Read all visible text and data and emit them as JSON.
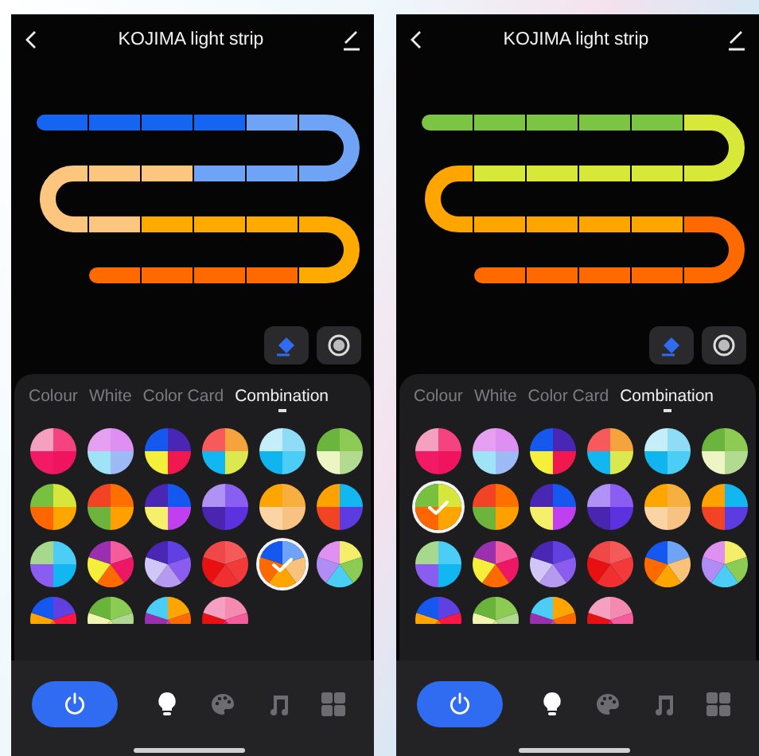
{
  "screens": [
    {
      "title": "KOJIMA light strip",
      "strip": [
        {
          "color": "#1565f0"
        },
        {
          "color": "#1565f0"
        },
        {
          "color": "#1565f0"
        },
        {
          "color": "#1565f0"
        },
        {
          "color": "#6fa3f5"
        },
        {
          "color": "#6fa3f5"
        },
        {
          "color": "#6fa3f5"
        },
        {
          "color": "#6fa3f5"
        },
        {
          "color": "#fcc67e"
        },
        {
          "color": "#fcc67e"
        },
        {
          "color": "#fcc67e"
        },
        {
          "color": "#fcc67e"
        },
        {
          "color": "#ffaa00"
        },
        {
          "color": "#ffaa00"
        },
        {
          "color": "#ffaa00"
        },
        {
          "color": "#ffaa00"
        },
        {
          "color": "#ff6a00"
        },
        {
          "color": "#ff6a00"
        },
        {
          "color": "#ff6a00"
        },
        {
          "color": "#ff6a00"
        }
      ],
      "tabs": [
        {
          "label": "Colour",
          "selected": false
        },
        {
          "label": "White",
          "selected": false
        },
        {
          "label": "Color Card",
          "selected": false
        },
        {
          "label": "Combination",
          "selected": true
        }
      ],
      "swatches": [
        {
          "slices": [
            {
              "color": "#f5437f"
            },
            {
              "color": "#f0145e"
            },
            {
              "color": "#f21a64"
            },
            {
              "color": "#f4a0be"
            }
          ],
          "selected": false
        },
        {
          "slices": [
            {
              "color": "#de90f2"
            },
            {
              "color": "#9dbaf7"
            },
            {
              "color": "#9fe3f7"
            },
            {
              "color": "#e6a0f2"
            }
          ],
          "selected": false
        },
        {
          "slices": [
            {
              "color": "#4a26b4"
            },
            {
              "color": "#f0184e"
            },
            {
              "color": "#f5ee3a"
            },
            {
              "color": "#1458f0"
            }
          ],
          "selected": false
        },
        {
          "slices": [
            {
              "color": "#f5a33c"
            },
            {
              "color": "#dbe94e"
            },
            {
              "color": "#12b6f0"
            },
            {
              "color": "#f65a5a"
            }
          ],
          "selected": false
        },
        {
          "slices": [
            {
              "color": "#8fdcf7"
            },
            {
              "color": "#4ccdf5"
            },
            {
              "color": "#10b5ef"
            },
            {
              "color": "#c5edfa"
            }
          ],
          "selected": false
        },
        {
          "slices": [
            {
              "color": "#8ecb55"
            },
            {
              "color": "#b2da90"
            },
            {
              "color": "#eef5c5"
            },
            {
              "color": "#6bb43e"
            }
          ],
          "selected": false
        },
        {
          "slices": [
            {
              "color": "#d6e63a"
            },
            {
              "color": "#ffa500"
            },
            {
              "color": "#ff6600"
            },
            {
              "color": "#78c040"
            }
          ],
          "selected": false
        },
        {
          "slices": [
            {
              "color": "#ff7000"
            },
            {
              "color": "#ffa000"
            },
            {
              "color": "#6cb43c"
            },
            {
              "color": "#f24424"
            }
          ],
          "selected": false
        },
        {
          "slices": [
            {
              "color": "#1458f0"
            },
            {
              "color": "#c040f0"
            },
            {
              "color": "#f5ef6a"
            },
            {
              "color": "#4a26b4"
            }
          ],
          "selected": false
        },
        {
          "slices": [
            {
              "color": "#8b5ef2"
            },
            {
              "color": "#5c32e0"
            },
            {
              "color": "#4a26b0"
            },
            {
              "color": "#b092f5"
            }
          ],
          "selected": false
        },
        {
          "slices": [
            {
              "color": "#f7b040"
            },
            {
              "color": "#f7c282"
            },
            {
              "color": "#fbd4a6"
            },
            {
              "color": "#ffa500"
            }
          ],
          "selected": false
        },
        {
          "slices": [
            {
              "color": "#12b6f0"
            },
            {
              "color": "#5c3ce0"
            },
            {
              "color": "#f24424"
            },
            {
              "color": "#ffa200"
            }
          ],
          "selected": false
        },
        {
          "slices": [
            {
              "color": "#4ccdf5"
            },
            {
              "color": "#12b6f0"
            },
            {
              "color": "#8a5cf0"
            },
            {
              "color": "#a8d890"
            }
          ],
          "selected": false
        },
        {
          "slices": [
            {
              "color": "#f55c9c"
            },
            {
              "color": "#ee1766"
            },
            {
              "color": "#ff6a00"
            },
            {
              "color": "#f5ee3a"
            },
            {
              "color": "#9a30b0"
            }
          ],
          "selected": false
        },
        {
          "slices": [
            {
              "color": "#6040e0"
            },
            {
              "color": "#8a5cf0"
            },
            {
              "color": "#b59af0"
            },
            {
              "color": "#d0c6f8"
            },
            {
              "color": "#4a26b4"
            }
          ],
          "selected": false
        },
        {
          "slices": [
            {
              "color": "#f55a5a"
            },
            {
              "color": "#f23a3a"
            },
            {
              "color": "#f03030"
            },
            {
              "color": "#e81010"
            },
            {
              "color": "#f04848"
            }
          ],
          "selected": false
        },
        {
          "slices": [
            {
              "color": "#6fa3f5"
            },
            {
              "color": "#f9c27a"
            },
            {
              "color": "#ffa500"
            },
            {
              "color": "#ff6a00"
            },
            {
              "color": "#1458f0"
            }
          ],
          "selected": true
        },
        {
          "slices": [
            {
              "color": "#f5ee6a"
            },
            {
              "color": "#8ccc54"
            },
            {
              "color": "#4ccdf5"
            },
            {
              "color": "#b08cf5"
            },
            {
              "color": "#e090f0"
            }
          ],
          "selected": false
        },
        {
          "slices": [
            {
              "color": "#6040e0"
            },
            {
              "color": "#ff1744"
            },
            {
              "color": "#ff6a00"
            },
            {
              "color": "#ffa500"
            },
            {
              "color": "#1458f0"
            }
          ],
          "selected": false
        },
        {
          "slices": [
            {
              "color": "#8ccc54"
            },
            {
              "color": "#b0d890"
            },
            {
              "color": "#d8e880"
            },
            {
              "color": "#f0f6b0"
            },
            {
              "color": "#6ab43c"
            }
          ],
          "selected": false
        },
        {
          "slices": [
            {
              "color": "#ffa500"
            },
            {
              "color": "#ff6a00"
            },
            {
              "color": "#c040c0"
            },
            {
              "color": "#9a30b0"
            },
            {
              "color": "#4ccdf5"
            }
          ],
          "selected": false
        },
        {
          "slices": [
            {
              "color": "#f58ab0"
            },
            {
              "color": "#f55c9c"
            },
            {
              "color": "#ee1766"
            },
            {
              "color": "#e81010"
            },
            {
              "color": "#f5a0c0"
            }
          ],
          "selected": false
        }
      ],
      "power": {
        "on": true
      },
      "nav": [
        {
          "kind": "bulb",
          "selected": true
        },
        {
          "kind": "palette",
          "selected": false
        },
        {
          "kind": "music",
          "selected": false
        },
        {
          "kind": "grid",
          "selected": false
        }
      ]
    },
    {
      "title": "KOJIMA light strip",
      "strip": [
        {
          "color": "#7cc444"
        },
        {
          "color": "#7cc444"
        },
        {
          "color": "#7cc444"
        },
        {
          "color": "#7cc444"
        },
        {
          "color": "#7cc444"
        },
        {
          "color": "#d8e838"
        },
        {
          "color": "#d8e838"
        },
        {
          "color": "#d8e838"
        },
        {
          "color": "#d8e838"
        },
        {
          "color": "#d8e838"
        },
        {
          "color": "#ffa500"
        },
        {
          "color": "#ffa500"
        },
        {
          "color": "#ffa500"
        },
        {
          "color": "#ffa500"
        },
        {
          "color": "#ffa500"
        },
        {
          "color": "#ff6a00"
        },
        {
          "color": "#ff6a00"
        },
        {
          "color": "#ff6a00"
        },
        {
          "color": "#ff6a00"
        },
        {
          "color": "#ff6a00"
        }
      ],
      "tabs": [
        {
          "label": "Colour",
          "selected": false
        },
        {
          "label": "White",
          "selected": false
        },
        {
          "label": "Color Card",
          "selected": false
        },
        {
          "label": "Combination",
          "selected": true
        }
      ],
      "swatches": [
        {
          "slices": [
            {
              "color": "#f5437f"
            },
            {
              "color": "#f0145e"
            },
            {
              "color": "#f21a64"
            },
            {
              "color": "#f4a0be"
            }
          ],
          "selected": false
        },
        {
          "slices": [
            {
              "color": "#de90f2"
            },
            {
              "color": "#9dbaf7"
            },
            {
              "color": "#9fe3f7"
            },
            {
              "color": "#e6a0f2"
            }
          ],
          "selected": false
        },
        {
          "slices": [
            {
              "color": "#4a26b4"
            },
            {
              "color": "#f0184e"
            },
            {
              "color": "#f5ee3a"
            },
            {
              "color": "#1458f0"
            }
          ],
          "selected": false
        },
        {
          "slices": [
            {
              "color": "#f5a33c"
            },
            {
              "color": "#dbe94e"
            },
            {
              "color": "#12b6f0"
            },
            {
              "color": "#f65a5a"
            }
          ],
          "selected": false
        },
        {
          "slices": [
            {
              "color": "#8fdcf7"
            },
            {
              "color": "#4ccdf5"
            },
            {
              "color": "#10b5ef"
            },
            {
              "color": "#c5edfa"
            }
          ],
          "selected": false
        },
        {
          "slices": [
            {
              "color": "#8ecb55"
            },
            {
              "color": "#b2da90"
            },
            {
              "color": "#eef5c5"
            },
            {
              "color": "#6bb43e"
            }
          ],
          "selected": false
        },
        {
          "slices": [
            {
              "color": "#d6e63a"
            },
            {
              "color": "#ffa500"
            },
            {
              "color": "#ff6600"
            },
            {
              "color": "#78c040"
            }
          ],
          "selected": true
        },
        {
          "slices": [
            {
              "color": "#ff7000"
            },
            {
              "color": "#ffa000"
            },
            {
              "color": "#6cb43c"
            },
            {
              "color": "#f24424"
            }
          ],
          "selected": false
        },
        {
          "slices": [
            {
              "color": "#1458f0"
            },
            {
              "color": "#c040f0"
            },
            {
              "color": "#f5ef6a"
            },
            {
              "color": "#4a26b4"
            }
          ],
          "selected": false
        },
        {
          "slices": [
            {
              "color": "#8b5ef2"
            },
            {
              "color": "#5c32e0"
            },
            {
              "color": "#4a26b0"
            },
            {
              "color": "#b092f5"
            }
          ],
          "selected": false
        },
        {
          "slices": [
            {
              "color": "#f7b040"
            },
            {
              "color": "#f7c282"
            },
            {
              "color": "#fbd4a6"
            },
            {
              "color": "#ffa500"
            }
          ],
          "selected": false
        },
        {
          "slices": [
            {
              "color": "#12b6f0"
            },
            {
              "color": "#5c3ce0"
            },
            {
              "color": "#f24424"
            },
            {
              "color": "#ffa200"
            }
          ],
          "selected": false
        },
        {
          "slices": [
            {
              "color": "#4ccdf5"
            },
            {
              "color": "#12b6f0"
            },
            {
              "color": "#8a5cf0"
            },
            {
              "color": "#a8d890"
            }
          ],
          "selected": false
        },
        {
          "slices": [
            {
              "color": "#f55c9c"
            },
            {
              "color": "#ee1766"
            },
            {
              "color": "#ff6a00"
            },
            {
              "color": "#f5ee3a"
            },
            {
              "color": "#9a30b0"
            }
          ],
          "selected": false
        },
        {
          "slices": [
            {
              "color": "#6040e0"
            },
            {
              "color": "#8a5cf0"
            },
            {
              "color": "#b59af0"
            },
            {
              "color": "#d0c6f8"
            },
            {
              "color": "#4a26b4"
            }
          ],
          "selected": false
        },
        {
          "slices": [
            {
              "color": "#f55a5a"
            },
            {
              "color": "#f23a3a"
            },
            {
              "color": "#f03030"
            },
            {
              "color": "#e81010"
            },
            {
              "color": "#f04848"
            }
          ],
          "selected": false
        },
        {
          "slices": [
            {
              "color": "#6fa3f5"
            },
            {
              "color": "#f9c27a"
            },
            {
              "color": "#ffa500"
            },
            {
              "color": "#ff6a00"
            },
            {
              "color": "#1458f0"
            }
          ],
          "selected": false
        },
        {
          "slices": [
            {
              "color": "#f5ee6a"
            },
            {
              "color": "#8ccc54"
            },
            {
              "color": "#4ccdf5"
            },
            {
              "color": "#b08cf5"
            },
            {
              "color": "#e090f0"
            }
          ],
          "selected": false
        },
        {
          "slices": [
            {
              "color": "#6040e0"
            },
            {
              "color": "#ff1744"
            },
            {
              "color": "#ff6a00"
            },
            {
              "color": "#ffa500"
            },
            {
              "color": "#1458f0"
            }
          ],
          "selected": false
        },
        {
          "slices": [
            {
              "color": "#8ccc54"
            },
            {
              "color": "#b0d890"
            },
            {
              "color": "#d8e880"
            },
            {
              "color": "#f0f6b0"
            },
            {
              "color": "#6ab43c"
            }
          ],
          "selected": false
        },
        {
          "slices": [
            {
              "color": "#ffa500"
            },
            {
              "color": "#ff6a00"
            },
            {
              "color": "#c040c0"
            },
            {
              "color": "#9a30b0"
            },
            {
              "color": "#4ccdf5"
            }
          ],
          "selected": false
        },
        {
          "slices": [
            {
              "color": "#f58ab0"
            },
            {
              "color": "#f55c9c"
            },
            {
              "color": "#ee1766"
            },
            {
              "color": "#e81010"
            },
            {
              "color": "#f5a0c0"
            }
          ],
          "selected": false
        }
      ],
      "power": {
        "on": true
      },
      "nav": [
        {
          "kind": "bulb",
          "selected": true
        },
        {
          "kind": "palette",
          "selected": false
        },
        {
          "kind": "music",
          "selected": false
        },
        {
          "kind": "grid",
          "selected": false
        }
      ]
    }
  ]
}
